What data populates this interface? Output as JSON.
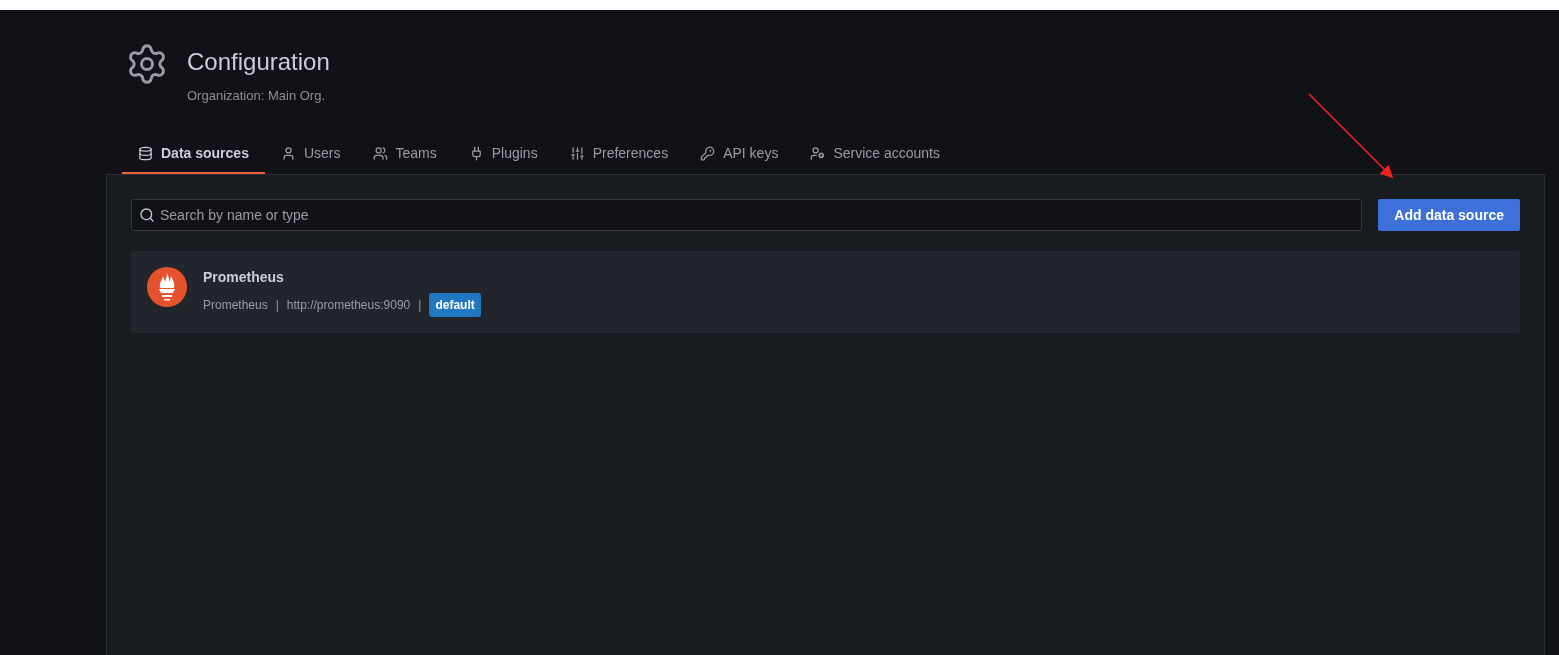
{
  "header": {
    "title": "Configuration",
    "subtitle": "Organization: Main Org."
  },
  "tabs": [
    {
      "label": "Data sources",
      "kind": "database",
      "selected": true
    },
    {
      "label": "Users",
      "kind": "user",
      "selected": false
    },
    {
      "label": "Teams",
      "kind": "users",
      "selected": false
    },
    {
      "label": "Plugins",
      "kind": "plug",
      "selected": false
    },
    {
      "label": "Preferences",
      "kind": "sliders",
      "selected": false
    },
    {
      "label": "API keys",
      "kind": "key",
      "selected": false
    },
    {
      "label": "Service accounts",
      "kind": "usercog",
      "selected": false
    }
  ],
  "search": {
    "placeholder": "Search by name or type"
  },
  "add_button": "Add data source",
  "data_sources": [
    {
      "name": "Prometheus",
      "type": "Prometheus",
      "url": "http://prometheus:9090",
      "badge": "default",
      "separators": [
        "|",
        "|"
      ]
    }
  ]
}
